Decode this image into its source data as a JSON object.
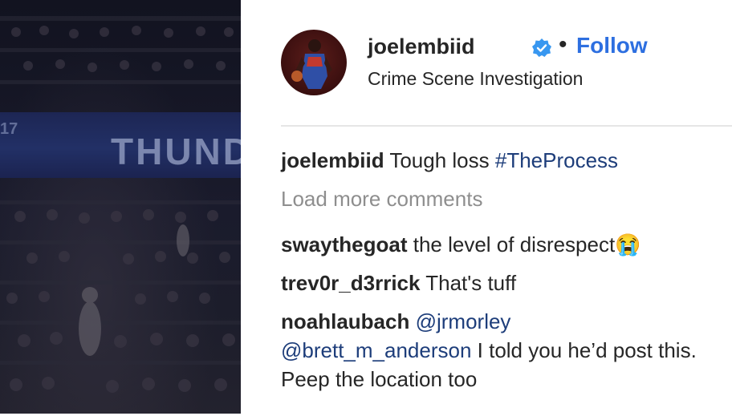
{
  "post_image": {
    "banner_number": "17",
    "banner_text": "THUND"
  },
  "header": {
    "username": "joelembiid",
    "separator": "•",
    "follow_label": "Follow",
    "location": "Crime Scene Investigation"
  },
  "caption": {
    "user": "joelembiid",
    "text": "Tough loss ",
    "hashtag": "#TheProcess"
  },
  "load_more_label": "Load more comments",
  "comments": [
    {
      "user": "swaythegoat",
      "text": "the level of disrespect😭"
    },
    {
      "user": "trev0r_d3rrick",
      "text": "That's tuff"
    },
    {
      "user": "noahlaubach",
      "mention1": "@jrmorley",
      "mention2": "@brett_m_anderson",
      "text": " I told you he’d post this. Peep the location too"
    }
  ],
  "colors": {
    "accent": "#2d6fe0",
    "text": "#262626",
    "muted": "#8e8e8e",
    "verified": "#3897f0"
  }
}
